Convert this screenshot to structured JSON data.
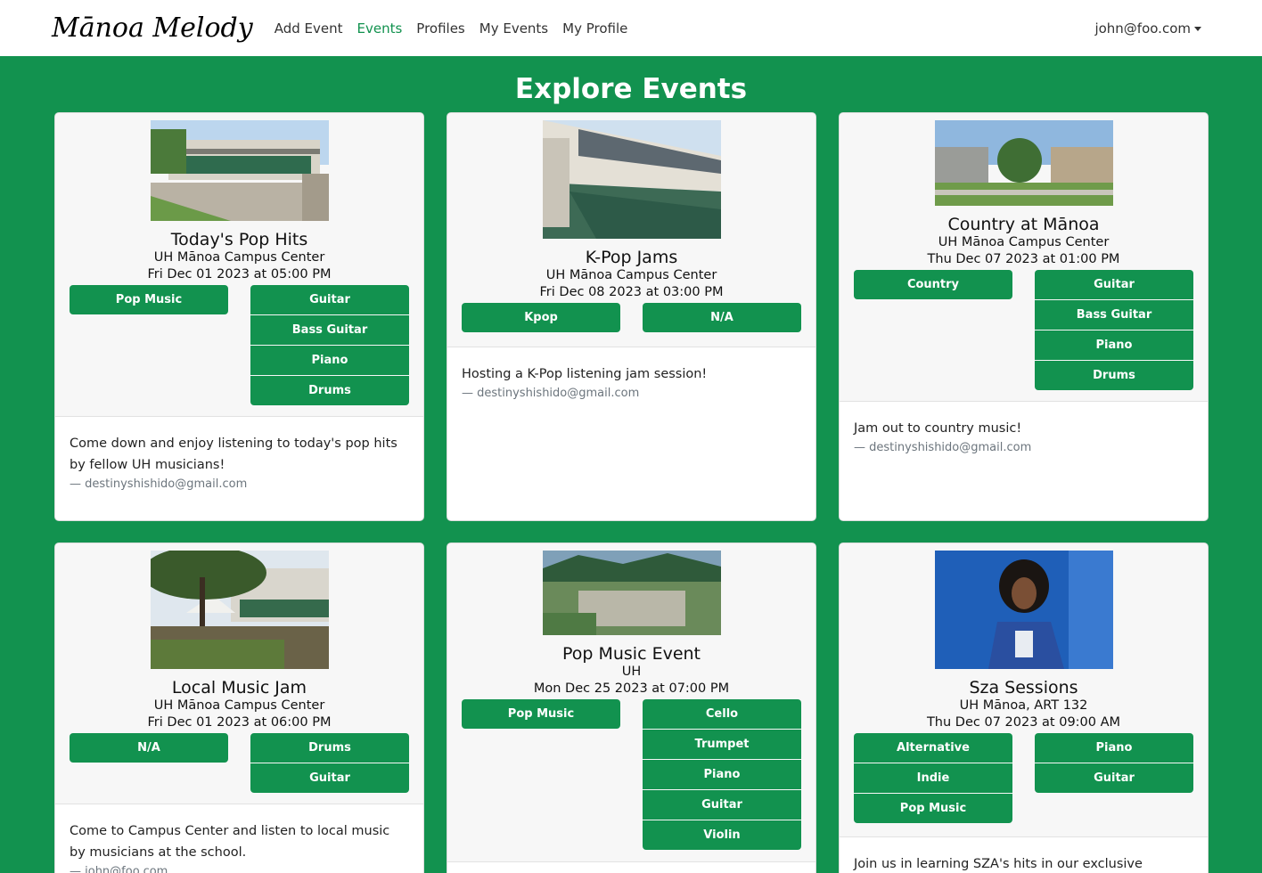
{
  "nav": {
    "brand": "Mānoa Melody",
    "links": [
      "Add Event",
      "Events",
      "Profiles",
      "My Events",
      "My Profile"
    ],
    "active": "Events",
    "user": "john@foo.com"
  },
  "page": {
    "title": "Explore Events"
  },
  "events": [
    {
      "title": "Today's Pop Hits",
      "location": "UH Mānoa Campus Center",
      "date": "Fri Dec 01 2023 at 05:00 PM",
      "genres": [
        "Pop Music"
      ],
      "instruments": [
        "Guitar",
        "Bass Guitar",
        "Piano",
        "Drums"
      ],
      "description": "Come down and enjoy listening to today's pop hits by fellow UH musicians!",
      "author": "— destinyshishido@gmail.com"
    },
    {
      "title": "K-Pop Jams",
      "location": "UH Mānoa Campus Center",
      "date": "Fri Dec 08 2023 at 03:00 PM",
      "genres": [
        "Kpop"
      ],
      "instruments": [
        "N/A"
      ],
      "description": "Hosting a K-Pop listening jam session!",
      "author": "— destinyshishido@gmail.com"
    },
    {
      "title": "Country at Mānoa",
      "location": "UH Mānoa Campus Center",
      "date": "Thu Dec 07 2023 at 01:00 PM",
      "genres": [
        "Country"
      ],
      "instruments": [
        "Guitar",
        "Bass Guitar",
        "Piano",
        "Drums"
      ],
      "description": "Jam out to country music!",
      "author": "— destinyshishido@gmail.com"
    },
    {
      "title": "Local Music Jam",
      "location": "UH Mānoa Campus Center",
      "date": "Fri Dec 01 2023 at 06:00 PM",
      "genres": [
        "N/A"
      ],
      "instruments": [
        "Drums",
        "Guitar"
      ],
      "description": "Come to Campus Center and listen to local music by musicians at the school.",
      "author": "— john@foo.com"
    },
    {
      "title": "Pop Music Event",
      "location": "UH",
      "date": "Mon Dec 25 2023 at 07:00 PM",
      "genres": [
        "Pop Music"
      ],
      "instruments": [
        "Cello",
        "Trumpet",
        "Piano",
        "Guitar",
        "Violin"
      ],
      "description": "",
      "author": ""
    },
    {
      "title": "Sza Sessions",
      "location": "UH Mānoa, ART 132",
      "date": "Thu Dec 07 2023 at 09:00 AM",
      "genres": [
        "Alternative",
        "Indie",
        "Pop Music"
      ],
      "instruments": [
        "Piano",
        "Guitar"
      ],
      "description": "Join us in learning SZA's hits in our exclusive",
      "author": ""
    }
  ],
  "colors": {
    "brand_green": "#12924f",
    "card_bg": "#f7f7f7"
  }
}
